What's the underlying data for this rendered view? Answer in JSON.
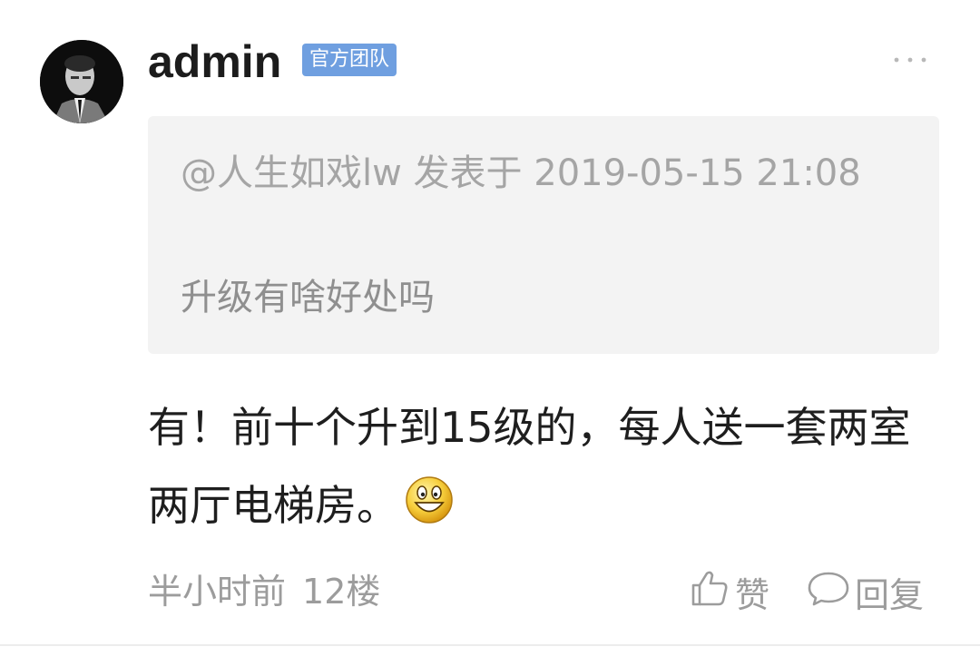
{
  "post": {
    "author": {
      "name": "admin",
      "badge": "官方团队",
      "avatar": "avatar-photo"
    },
    "more_icon": "more-horizontal-icon",
    "quote": {
      "meta": "@人生如戏lw 发表于 2019-05-15 21:08",
      "text": "升级有啥好处吗"
    },
    "reply_text": "有！前十个升到15级的，每人送一套两室两厅电梯房。",
    "reply_emoji": "grinning-face-icon",
    "footer": {
      "time": "半小时前",
      "floor": "12楼",
      "like_label": "赞",
      "reply_label": "回复"
    }
  },
  "colors": {
    "badge_bg": "#6f9fe0",
    "quote_bg": "#f3f3f3",
    "muted_text": "#9c9c9c",
    "main_text": "#1e1e1e"
  }
}
